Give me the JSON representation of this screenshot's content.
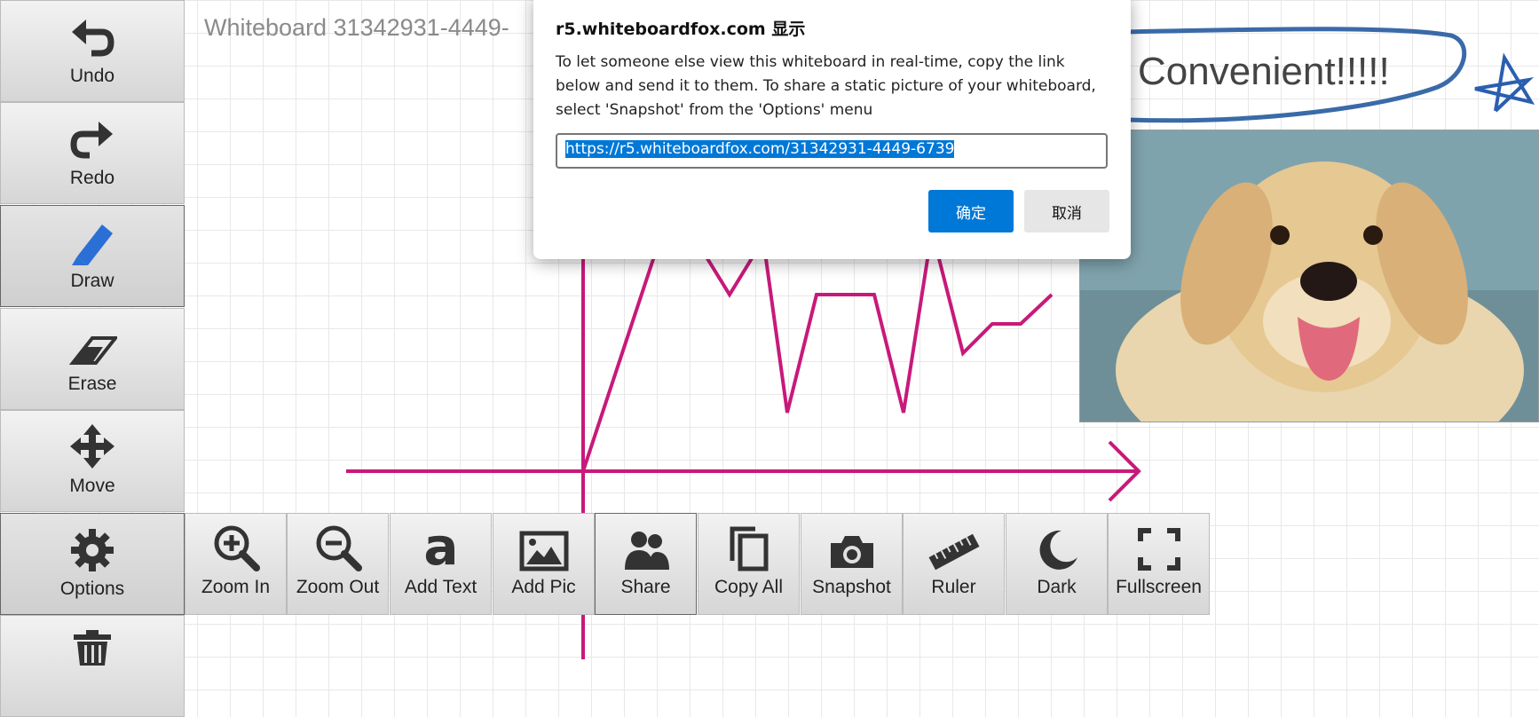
{
  "board": {
    "title": "Whiteboard 31342931-4449-",
    "canvas_text": "Convenient!!!!!"
  },
  "sidebar": {
    "items": [
      {
        "label": "Undo",
        "icon": "undo-icon"
      },
      {
        "label": "Redo",
        "icon": "redo-icon"
      },
      {
        "label": "Draw",
        "icon": "pencil-icon",
        "active": true
      },
      {
        "label": "Erase",
        "icon": "eraser-icon"
      },
      {
        "label": "Move",
        "icon": "move-icon"
      },
      {
        "label": "Options",
        "icon": "gear-icon",
        "active": true
      },
      {
        "label": "",
        "icon": "trash-icon"
      }
    ]
  },
  "options_menu": {
    "items": [
      {
        "label": "Zoom In",
        "icon": "zoom-in-icon"
      },
      {
        "label": "Zoom Out",
        "icon": "zoom-out-icon"
      },
      {
        "label": "Add Text",
        "icon": "text-icon"
      },
      {
        "label": "Add Pic",
        "icon": "picture-icon"
      },
      {
        "label": "Share",
        "icon": "users-icon",
        "active": true
      },
      {
        "label": "Copy All",
        "icon": "copy-icon"
      },
      {
        "label": "Snapshot",
        "icon": "camera-icon"
      },
      {
        "label": "Ruler",
        "icon": "ruler-icon"
      },
      {
        "label": "Dark",
        "icon": "moon-icon"
      },
      {
        "label": "Fullscreen",
        "icon": "fullscreen-icon"
      }
    ]
  },
  "dialog": {
    "title": "r5.whiteboardfox.com 显示",
    "message": "To let someone else view this whiteboard in real-time, copy the link below and send it to them. To share a static picture of your whiteboard, select 'Snapshot' from the 'Options' menu",
    "url_value": "https://r5.whiteboardfox.com/31342931-4449-6739",
    "ok_label": "确定",
    "cancel_label": "取消"
  },
  "colors": {
    "drawing_stroke": "#c8197a",
    "circle_stroke": "#3a6aa8",
    "star_stroke": "#2a5fb0",
    "dialog_accent": "#0078d7"
  }
}
